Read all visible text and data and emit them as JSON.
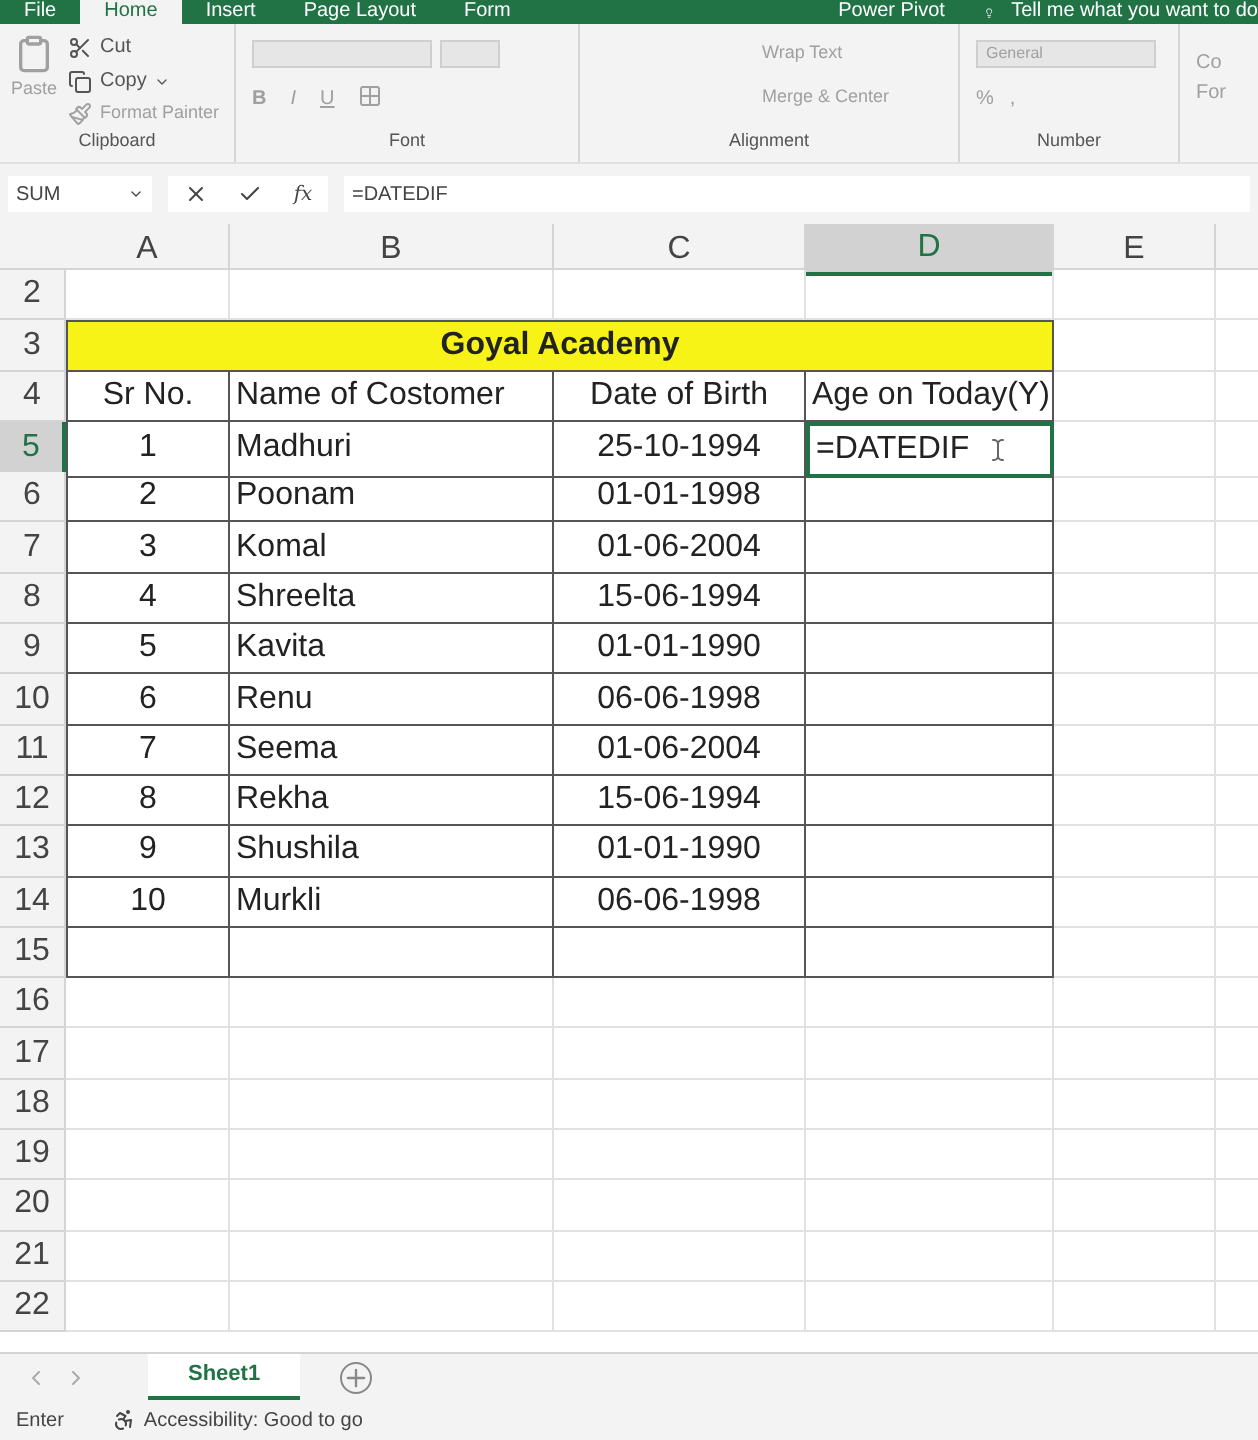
{
  "ribbon_tabs": [
    {
      "label": "File",
      "selected": false
    },
    {
      "label": "Home",
      "selected": true
    },
    {
      "label": "Insert",
      "selected": false
    },
    {
      "label": "Page Layout",
      "selected": false
    },
    {
      "label": "Form",
      "selected": false
    }
  ],
  "ribbon_tabs_right": [
    {
      "label": "Power Pivot",
      "selected": false
    }
  ],
  "tell_me": "Tell me what you want to do",
  "clipboard": {
    "paste": "Paste",
    "cut": "Cut",
    "copy": "Copy",
    "format_painter": "Format Painter",
    "label": "Clipboard"
  },
  "font": {
    "bold": "B",
    "italic": "I",
    "underline": "U",
    "label": "Font"
  },
  "alignment": {
    "wrap_text": "Wrap Text",
    "merge_center": "Merge & Center",
    "label": "Alignment"
  },
  "number": {
    "format": "General",
    "percent": "%",
    "comma": ",",
    "label": "Number"
  },
  "next_group_cut": [
    "Co",
    "For"
  ],
  "formula_bar": {
    "name_box": "SUM",
    "fx": "fx",
    "formula": "=DATEDIF"
  },
  "columns": [
    {
      "label": "A",
      "selected": false
    },
    {
      "label": "B",
      "selected": false
    },
    {
      "label": "C",
      "selected": false
    },
    {
      "label": "D",
      "selected": true
    },
    {
      "label": "E",
      "selected": false
    }
  ],
  "rows": [
    {
      "number": "2",
      "selected": false,
      "kind": "blank"
    },
    {
      "number": "3",
      "selected": false,
      "kind": "title",
      "cells": [
        "Goyal Academy"
      ]
    },
    {
      "number": "4",
      "selected": false,
      "kind": "table",
      "cells": [
        "Sr No.",
        "Name of Costomer",
        "Date of Birth",
        "Age on Today(Y)"
      ]
    },
    {
      "number": "5",
      "selected": true,
      "kind": "table",
      "cells": [
        "1",
        "Madhuri",
        "25-10-1994",
        "=DATEDIF"
      ]
    },
    {
      "number": "6",
      "selected": false,
      "kind": "table",
      "cells": [
        "2",
        "Poonam",
        "01-01-1998"
      ]
    },
    {
      "number": "7",
      "selected": false,
      "kind": "table",
      "cells": [
        "3",
        "Komal",
        "01-06-2004"
      ]
    },
    {
      "number": "8",
      "selected": false,
      "kind": "table",
      "cells": [
        "4",
        "Shreelta",
        "15-06-1994"
      ]
    },
    {
      "number": "9",
      "selected": false,
      "kind": "table",
      "cells": [
        "5",
        "Kavita",
        "01-01-1990"
      ]
    },
    {
      "number": "10",
      "selected": false,
      "kind": "table",
      "cells": [
        "6",
        "Renu",
        "06-06-1998"
      ]
    },
    {
      "number": "11",
      "selected": false,
      "kind": "table",
      "cells": [
        "7",
        "Seema",
        "01-06-2004"
      ]
    },
    {
      "number": "12",
      "selected": false,
      "kind": "table",
      "cells": [
        "8",
        "Rekha",
        "15-06-1994"
      ]
    },
    {
      "number": "13",
      "selected": false,
      "kind": "table",
      "cells": [
        "9",
        "Shushila",
        "01-01-1990"
      ]
    },
    {
      "number": "14",
      "selected": false,
      "kind": "table",
      "cells": [
        "10",
        "Murkli",
        "06-06-1998"
      ]
    },
    {
      "number": "15",
      "selected": false,
      "kind": "table",
      "cells": []
    },
    {
      "number": "16",
      "selected": false,
      "kind": "blank"
    },
    {
      "number": "17",
      "selected": false,
      "kind": "blank"
    },
    {
      "number": "18",
      "selected": false,
      "kind": "blank"
    },
    {
      "number": "19",
      "selected": false,
      "kind": "blank"
    },
    {
      "number": "20",
      "selected": false,
      "kind": "blank"
    },
    {
      "number": "21",
      "selected": false,
      "kind": "blank"
    },
    {
      "number": "22",
      "selected": false,
      "kind": "blank"
    }
  ],
  "sheet_tabs": [
    {
      "label": "Sheet1",
      "selected": true
    }
  ],
  "status": {
    "mode": "Enter",
    "accessibility": "Accessibility: Good to go"
  }
}
